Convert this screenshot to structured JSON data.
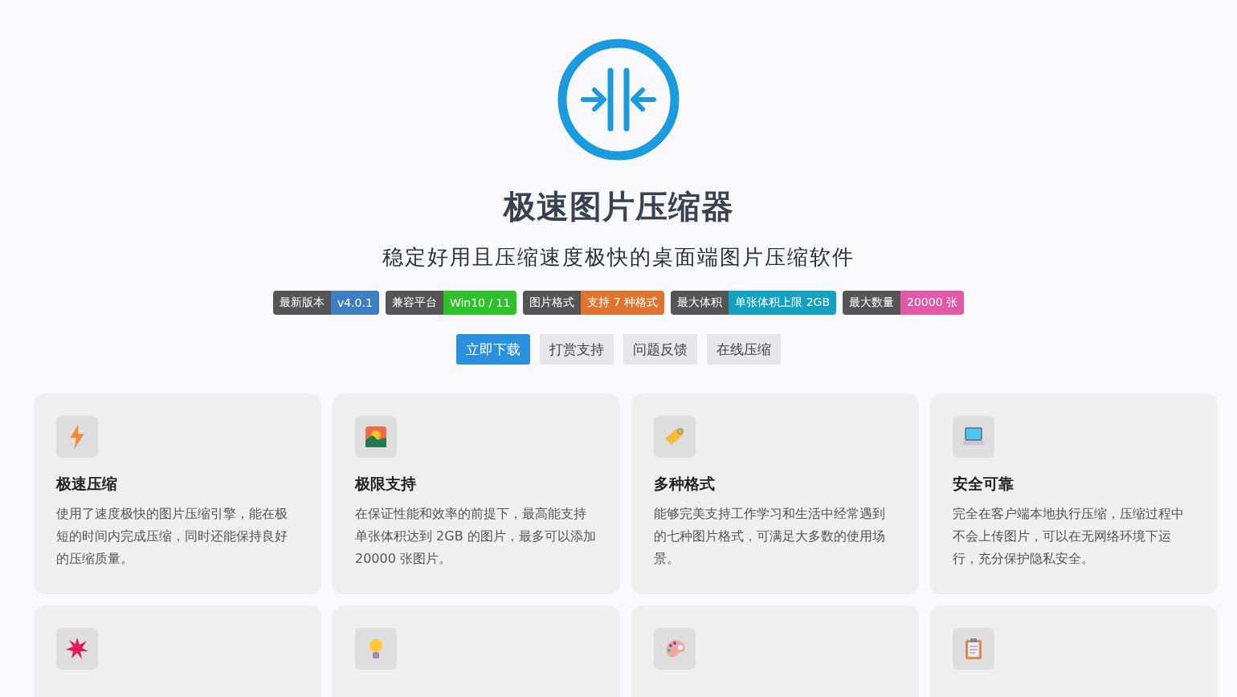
{
  "title": "极速图片压缩器",
  "subtitle": "稳定好用且压缩速度极快的桌面端图片压缩软件",
  "badges": [
    {
      "label": "最新版本",
      "value": "v4.0.1",
      "color": "#3d7fc1"
    },
    {
      "label": "兼容平台",
      "value": "Win10 / 11",
      "color": "#2fc12b"
    },
    {
      "label": "图片格式",
      "value": "支持 7 种格式",
      "color": "#e0742f"
    },
    {
      "label": "最大体积",
      "value": "单张体积上限 2GB",
      "color": "#14a1bf"
    },
    {
      "label": "最大数量",
      "value": "20000 张",
      "color": "#e05aa6"
    }
  ],
  "buttons": [
    {
      "label": "立即下载",
      "primary": true
    },
    {
      "label": "打赏支持",
      "primary": false
    },
    {
      "label": "问题反馈",
      "primary": false
    },
    {
      "label": "在线压缩",
      "primary": false
    }
  ],
  "features": [
    {
      "kind": "full",
      "title": "极速压缩",
      "description": "使用了速度极快的图片压缩引擎，能在极短的时间内完成压缩，同时还能保持良好的压缩质量。"
    },
    {
      "kind": "full",
      "title": "极限支持",
      "description": "在保证性能和效率的前提下，最高能支持单张体积达到 2GB 的图片，最多可以添加 20000 张图片。"
    },
    {
      "kind": "full",
      "title": "多种格式",
      "description": "能够完美支持工作学习和生活中经常遇到的七种图片格式，可满足大多数的使用场景。"
    },
    {
      "kind": "full",
      "title": "安全可靠",
      "description": "完全在客户端本地执行压缩，压缩过程中不会上传图片，可以在无网络环境下运行，充分保护隐私安全。"
    },
    {
      "kind": "cut"
    },
    {
      "kind": "cut"
    },
    {
      "kind": "cut"
    },
    {
      "kind": "cut"
    }
  ]
}
